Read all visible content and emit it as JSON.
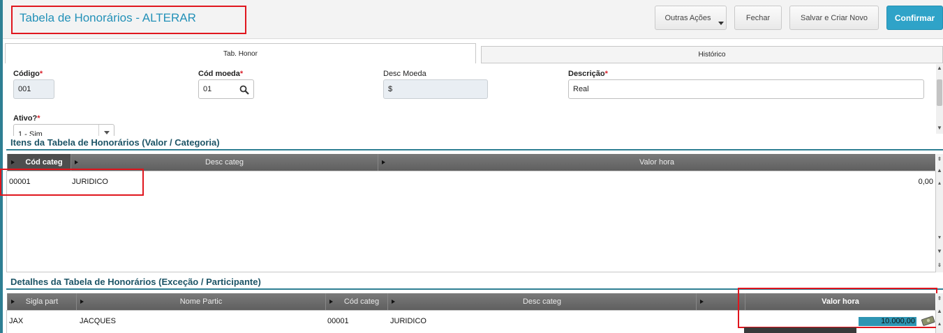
{
  "header": {
    "title": "Tabela de Honorários - ALTERAR",
    "buttons": {
      "outras_acoes": "Outras Ações",
      "fechar": "Fechar",
      "salvar_criar": "Salvar e Criar Novo",
      "confirmar": "Confirmar"
    }
  },
  "tabs": [
    {
      "label": "Tab. Honor",
      "active": true
    },
    {
      "label": "Histórico",
      "active": false
    }
  ],
  "form": {
    "codigo": {
      "label": "Código",
      "required": "*",
      "value": "001"
    },
    "cod_moeda": {
      "label": "Cód moeda",
      "required": "*",
      "value": "01"
    },
    "desc_moeda": {
      "label": "Desc Moeda",
      "value": "$"
    },
    "descricao": {
      "label": "Descrição",
      "required": "*",
      "value": "Real"
    },
    "ativo": {
      "label": "Ativo?",
      "required": "*",
      "value": "1 - Sim"
    }
  },
  "itens": {
    "title": "Itens da Tabela de Honorários (Valor / Categoria)",
    "columns": [
      "Cód categ",
      "Desc categ",
      "Valor hora"
    ],
    "rows": [
      {
        "cod_categ": "00001",
        "desc_categ": "JURIDICO",
        "valor_hora": "0,00"
      }
    ]
  },
  "detalhes": {
    "title": "Detalhes da Tabela de Honorários (Exceção / Participante)",
    "columns": [
      "Sigla part",
      "Nome Partic",
      "Cód categ",
      "Desc categ",
      "Valor hora"
    ],
    "rows": [
      {
        "sigla_part": "JAX",
        "nome_partic": "JACQUES",
        "cod_categ": "00001",
        "desc_categ": "JURIDICO",
        "valor_hora": "10.000,00"
      }
    ]
  },
  "colors": {
    "title": "#2391b8",
    "accent": "#2fa3c8",
    "section": "#1d5466",
    "highlight": "#e0161e"
  },
  "icons": [
    "search-icon",
    "chevron-down-icon",
    "sort-arrow-icon",
    "money-icon",
    "scroll-up-icon",
    "scroll-down-icon"
  ]
}
